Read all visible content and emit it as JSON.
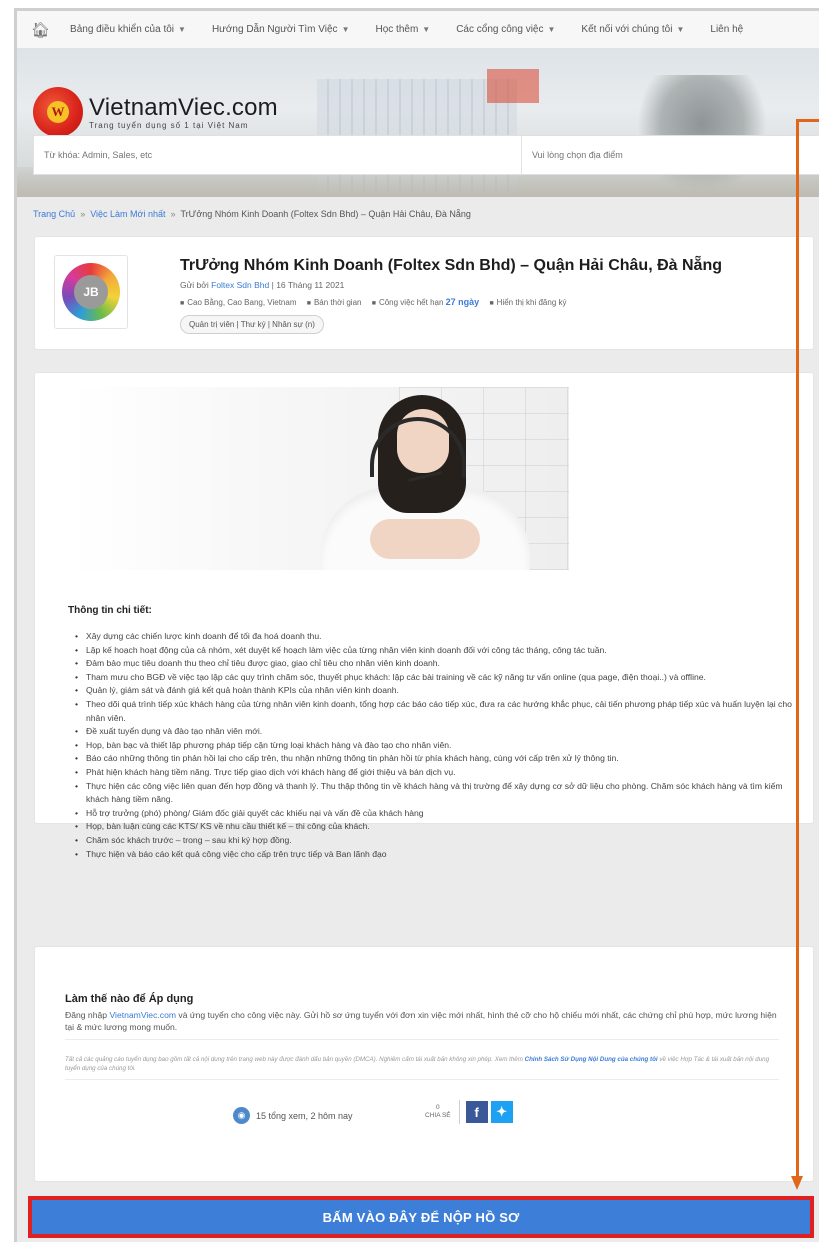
{
  "nav": {
    "items": [
      {
        "label": "Bảng điều khiển của tôi",
        "dropdown": true
      },
      {
        "label": "Hướng Dẫn Người Tìm Việc",
        "dropdown": true
      },
      {
        "label": "Học thêm",
        "dropdown": true
      },
      {
        "label": "Các cổng công việc",
        "dropdown": true
      },
      {
        "label": "Kết nối với chúng tôi",
        "dropdown": true
      },
      {
        "label": "Liên hệ",
        "dropdown": false
      }
    ]
  },
  "brand": {
    "name": "VietnamViec.com",
    "tagline": "Trang tuyển dụng số 1 tại Việt Nam",
    "logo_letter": "W"
  },
  "search": {
    "keyword_placeholder": "Từ khóa: Admin, Sales, etc",
    "location_placeholder": "Vui lòng chọn địa điểm"
  },
  "breadcrumb": {
    "home": "Trang Chủ",
    "section": "Việc Làm Mới nhất",
    "current": "TrƯởng Nhóm Kinh Doanh (Foltex Sdn Bhd) – Quận Hải Châu, Đà Nẵng"
  },
  "job": {
    "title": "TrƯởng Nhóm Kinh Doanh (Foltex Sdn Bhd) – Quận Hải Châu, Đà Nẵng",
    "posted_prefix": "Gửi bởi",
    "company": "Foltex Sdn Bhd",
    "posted_date": "| 16 Tháng 11 2021",
    "location": "Cao Bằng, Cao Bang, Vietnam",
    "job_type": "Bán thời gian",
    "expires_prefix": "Công việc hết hạn",
    "expires_days": "27 ngày",
    "salary": "Hiển thị khi đăng ký",
    "category": "Quản trị viên | Thư ký | Nhân sự (n)",
    "logo_initials": "JB"
  },
  "description": {
    "section_title": "Thông tin chi tiết:",
    "duties": [
      "Xây dựng các chiến lược kinh doanh để tối đa hoá doanh thu.",
      "Lập kế hoạch hoạt động của cả nhóm, xét duyệt kế hoạch làm việc của từng nhân viên kinh doanh đối với công tác tháng, công tác tuần.",
      "Đảm bảo mục tiêu doanh thu theo chỉ tiêu được giao, giao chỉ tiêu cho nhân viên kinh doanh.",
      "Tham mưu cho BGĐ về việc tạo lập các quy trình chăm sóc, thuyết phục khách: lập các bài training về các kỹ năng tư vấn online (qua page, điện thoại..) và offline.",
      "Quản lý, giám sát và đánh giá kết quả hoàn thành KPIs của nhân viên kinh doanh.",
      "Theo dõi quá trình tiếp xúc khách hàng của từng nhân viên kinh doanh, tổng hợp các báo cáo tiếp xúc, đưa ra các hướng khắc phục, cải tiến phương pháp tiếp xúc và huấn luyện lại cho nhân viên.",
      "Đề xuất tuyển dụng và đào tạo nhân viên mới.",
      "Họp, bàn bạc và thiết lập phương pháp tiếp cận từng loại khách hàng và đào tạo cho nhân viên.",
      "Báo cáo những thông tin phản hồi lại cho cấp trên, thu nhận những thông tin phản hồi từ phía khách hàng, cùng với cấp trên xử lý thông tin.",
      "Phát hiện khách hàng tiềm năng. Trực tiếp giao dịch với khách hàng để giới thiệu và bán dịch vụ.",
      "Thực hiện các công việc liên quan đến hợp đồng và thanh lý. Thu thập thông tin về khách hàng và thị trường để xây dựng cơ sở dữ liệu cho phòng. Chăm sóc khách hàng và tìm kiếm khách hàng tiềm năng.",
      "Hỗ trợ trưởng (phó) phòng/ Giám đốc giải quyết các khiếu nại và vấn đề của khách hàng",
      "Họp, bàn luận cùng các KTS/ KS về nhu cầu thiết kế – thi công của khách.",
      "Chăm sóc khách trước – trong – sau khi ký hợp đồng.",
      "Thực hiện và báo cáo kết quả công việc cho cấp trên trực tiếp và Ban lãnh đạo"
    ]
  },
  "apply": {
    "title": "Làm thế nào để Áp dụng",
    "body_prefix": "Đăng nhập",
    "body_link": "VietnamViec.com",
    "body_rest": "và ứng tuyển cho công việc này. Gửi hồ sơ ứng tuyển với đơn xin việc mới nhất, hình thẻ cỡ cho hộ chiếu mới nhất, các chứng chỉ phù hợp, mức lương hiện tại & mức lương mong muốn.",
    "legal_text": "Tất cả các quảng cáo tuyển dụng bao gồm tất cả nội dung trên trang web này được đánh dấu bản quyền (DMCA). Nghiêm cấm tái xuất bản không xin phép. Xem thêm",
    "legal_link": "Chính Sách Sử Dụng Nội Dung của chúng tôi",
    "legal_rest": "về việc Hợp Tác & tái xuất bản nội dung tuyển dụng của chúng tôi.",
    "views": "15 tổng xem, 2 hôm nay",
    "share_count": "0",
    "share_label": "CHIA SẺ"
  },
  "cta": {
    "label": "BẤM VÀO ĐÂY ĐỂ NỘP HỒ SƠ"
  },
  "colors": {
    "link": "#3b7bd6",
    "cta_bg": "#3d7ed8",
    "cta_border": "#e02020",
    "annotation": "#e0661a"
  }
}
